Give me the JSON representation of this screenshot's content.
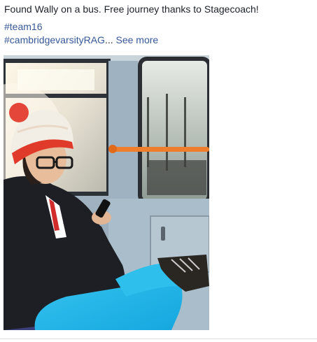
{
  "post": {
    "text": "Found Wally on a bus. Free journey thanks to Stagecoach!",
    "hashtags": [
      "#team16",
      "#cambridgevarsityRAG"
    ],
    "ellipsis": "...",
    "see_more": "See more"
  },
  "photo": {
    "subject": "person-in-red-white-bobble-hat-on-bus-photo"
  },
  "colors": {
    "link": "#365899",
    "text": "#1d2129",
    "divider": "#dddfe2"
  }
}
